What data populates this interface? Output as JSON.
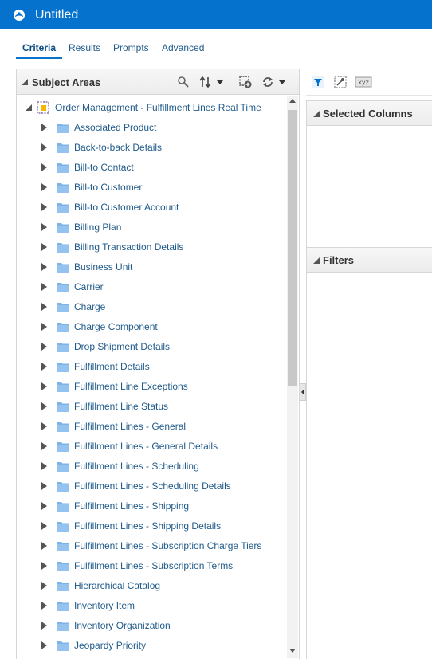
{
  "app": {
    "title": "Untitled"
  },
  "tabs": [
    {
      "label": "Criteria",
      "active": true
    },
    {
      "label": "Results"
    },
    {
      "label": "Prompts"
    },
    {
      "label": "Advanced"
    }
  ],
  "subject_areas": {
    "title": "Subject Areas",
    "toolbar_icons": [
      "search-icon",
      "sort-icon",
      "add-subject-area-icon",
      "refresh-icon"
    ],
    "root": "Order Management - Fulfillment Lines Real Time",
    "items": [
      "Associated Product",
      "Back-to-back Details",
      "Bill-to Contact",
      "Bill-to Customer",
      "Bill-to Customer Account",
      "Billing Plan",
      "Billing Transaction Details",
      "Business Unit",
      "Carrier",
      "Charge",
      "Charge Component",
      "Drop Shipment Details",
      "Fulfillment Details",
      "Fulfillment Line Exceptions",
      "Fulfillment Line Status",
      "Fulfillment Lines - General",
      "Fulfillment Lines - General Details",
      "Fulfillment Lines - Scheduling",
      "Fulfillment Lines - Scheduling Details",
      "Fulfillment Lines - Shipping",
      "Fulfillment Lines - Shipping Details",
      "Fulfillment Lines - Subscription Charge Tiers",
      "Fulfillment Lines - Subscription Terms",
      "Hierarchical Catalog",
      "Inventory Item",
      "Inventory Organization",
      "Jeopardy Priority"
    ]
  },
  "right_panel": {
    "toolbar_icons": [
      "filter-icon",
      "edit-formula-icon",
      "xyz-icon"
    ],
    "xyz_label": "xyz",
    "selected_columns_title": "Selected Columns",
    "filters_title": "Filters"
  },
  "colors": {
    "titlebar": "#0572ce",
    "link": "#1f5a8a",
    "folder": "#7db3e6"
  }
}
